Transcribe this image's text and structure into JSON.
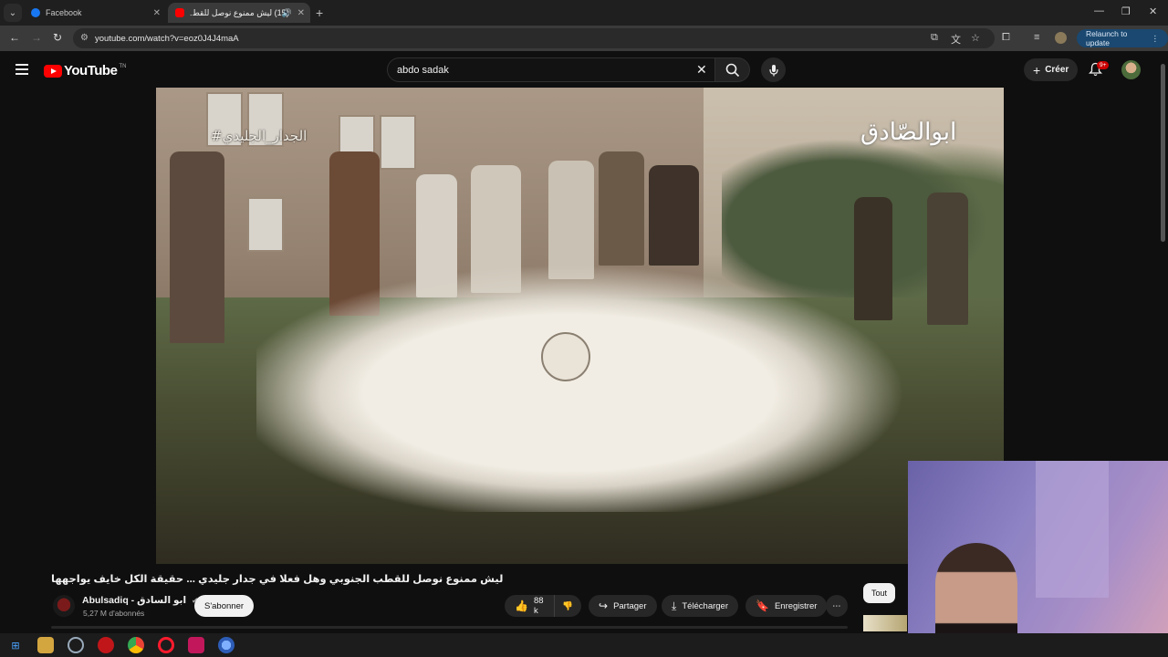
{
  "browser": {
    "tabs": [
      {
        "title": "Facebook",
        "active": false
      },
      {
        "title": "(15) ليش ممنوع نوصل للقط.",
        "active": true
      }
    ],
    "url": "youtube.com/watch?v=eoz0J4J4maA",
    "relaunch_label": "Relaunch to update"
  },
  "youtube": {
    "logo_text": "YouTube",
    "logo_tm": "TN",
    "search_value": "abdo sadak",
    "create_label": "Créer",
    "notif_badge": "9+"
  },
  "video": {
    "watermark_left": "#الجدار_الجليدي",
    "watermark_right": "ابوالصّادق",
    "title": "ليش ممنوع نوصل للقطب الجنوبي وهل فعلا في جدار جليدي ... حقيقة الكل خايف يواجهها",
    "channel": {
      "name": "Abulsadiq - ابو السادق",
      "subscribers": "5,27 M d'abonnés",
      "subscribe_label": "S'abonner"
    },
    "actions": {
      "likes": "88 k",
      "share": "Partager",
      "download": "Télécharger",
      "save": "Enregistrer"
    }
  },
  "filters": {
    "all_label": "Tout"
  },
  "colors": {
    "yt_red": "#ff0000",
    "relaunch_bg": "#1a4870",
    "bg": "#0f0f0f"
  }
}
